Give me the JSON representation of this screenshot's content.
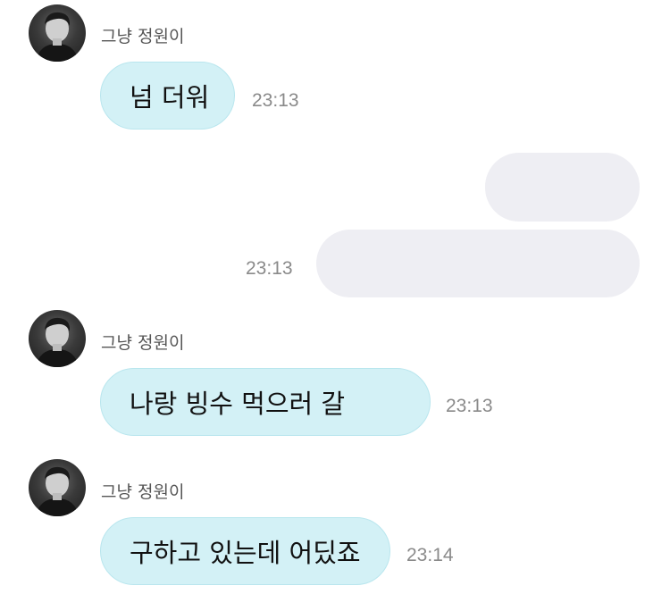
{
  "messages": [
    {
      "sender": "그냥 정원이",
      "text": "넘 더워",
      "time": "23:13"
    },
    {
      "time": "23:13"
    },
    {
      "sender": "그냥 정원이",
      "text": "나랑 빙수 먹으러 갈",
      "time": "23:13"
    },
    {
      "sender": "그냥 정원이",
      "text": "구하고 있는데 어딨죠",
      "time": "23:14"
    }
  ]
}
